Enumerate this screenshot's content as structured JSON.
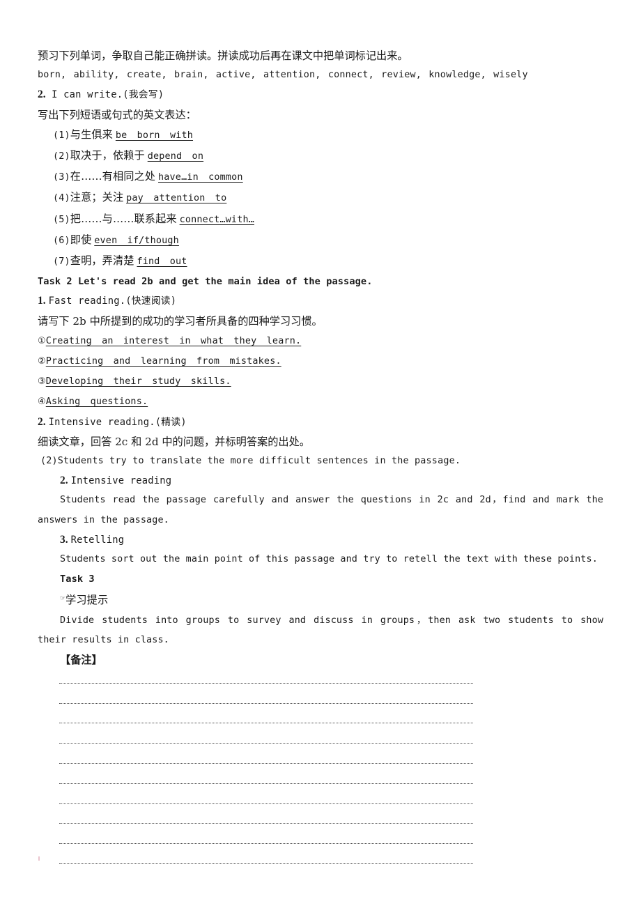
{
  "document": {
    "type": "worksheet",
    "language": "zh-CN/en"
  },
  "intro": {
    "instruction_cn": "预习下列单词，争取自己能正确拼读。拼读成功后再在课文中把单词标记出来。",
    "word_list": "born, ability, create, brain, active, attention, connect, review, knowledge, wisely"
  },
  "section_write": {
    "number": "2.",
    "title": "I can write.(我会写)",
    "prompt_cn": "写出下列短语或句式的英文表达：",
    "items": [
      {
        "marker": "(1)",
        "cn": "与生俱来",
        "answer": "be  born  with"
      },
      {
        "marker": "(2)",
        "cn": "取决于，依赖于",
        "answer": "depend  on"
      },
      {
        "marker": "(3)",
        "cn": "在……有相同之处",
        "answer": "have…in  common"
      },
      {
        "marker": "(4)",
        "cn": "注意；关注",
        "answer": "pay  attention  to"
      },
      {
        "marker": "(5)",
        "cn": "把……与……联系起来",
        "answer": "connect…with…"
      },
      {
        "marker": "(6)",
        "cn": "即使",
        "answer": "even  if/though"
      },
      {
        "marker": "(7)",
        "cn": "查明，弄清楚",
        "answer": "find  out"
      }
    ]
  },
  "task2": {
    "heading": "Task 2  Let's read 2b and get the main idea of the passage.",
    "fast_reading": {
      "number": "1.",
      "title": "Fast reading.(快速阅读)",
      "prompt_cn": "请写下 2b 中所提到的成功的学习者所具备的四种学习习惯。",
      "answers": [
        {
          "marker": "①",
          "text": "Creating  an  interest  in  what  they  learn."
        },
        {
          "marker": "②",
          "text": "Practicing  and  learning  from  mistakes."
        },
        {
          "marker": "③",
          "text": "Developing  their  study  skills."
        },
        {
          "marker": "④",
          "text": "Asking  questions."
        }
      ]
    },
    "intensive_reading": {
      "number": "2.",
      "title": "Intensive reading.(精读)",
      "prompt_cn": "细读文章，回答 2c 和 2d 中的问题，并标明答案的出处。",
      "note": "(2)Students try to translate the more difficult sentences in the passage."
    }
  },
  "procedure": {
    "step2": {
      "number": "2.",
      "title": "Intensive reading",
      "body": "Students read the passage carefully and answer the questions in 2c and 2d，find and mark the answers in the passage."
    },
    "step3": {
      "number": "3.",
      "title": "Retelling",
      "body": "Students sort out the main point of this passage and try to retell the text with these points."
    }
  },
  "task3": {
    "heading": "Task 3",
    "tip_icon": "pointing-hand-icon",
    "tip_label": "学习提示",
    "body": "Divide students into groups to survey and discuss in groups，then ask two students to show their results in class."
  },
  "notes": {
    "heading": "【备注】",
    "line_count": 10
  }
}
